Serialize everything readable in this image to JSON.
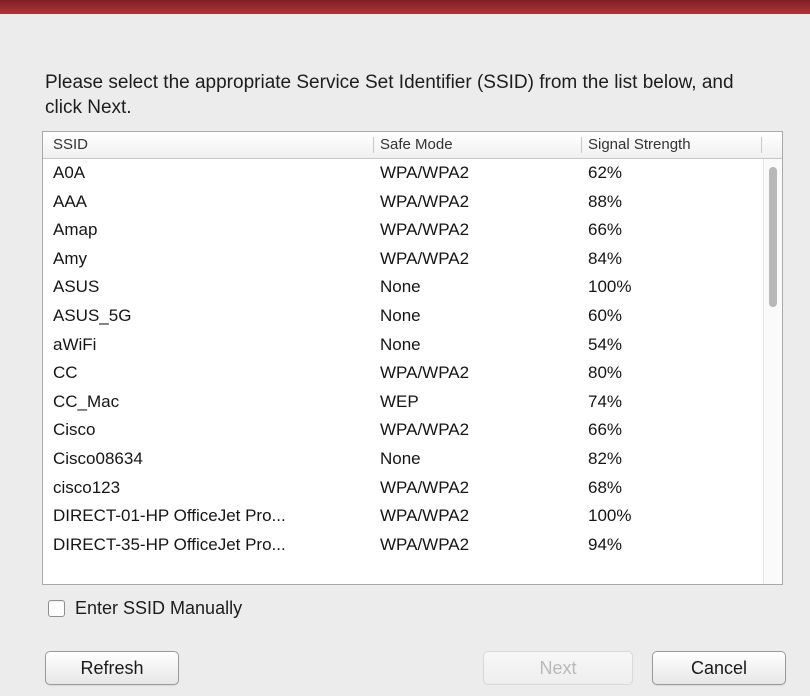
{
  "instructions": "Please select the appropriate Service Set Identifier (SSID) from the list below, and click Next.",
  "table": {
    "columns": [
      "SSID",
      "Safe Mode",
      "Signal Strength"
    ],
    "rows": [
      [
        "A0A",
        "WPA/WPA2",
        "62%"
      ],
      [
        "AAA",
        "WPA/WPA2",
        "88%"
      ],
      [
        "Amap",
        "WPA/WPA2",
        "66%"
      ],
      [
        "Amy",
        "WPA/WPA2",
        "84%"
      ],
      [
        "ASUS",
        "None",
        "100%"
      ],
      [
        "ASUS_5G",
        "None",
        "60%"
      ],
      [
        "aWiFi",
        "None",
        "54%"
      ],
      [
        "CC",
        "WPA/WPA2",
        "80%"
      ],
      [
        "CC_Mac",
        "WEP",
        "74%"
      ],
      [
        "Cisco",
        "WPA/WPA2",
        "66%"
      ],
      [
        "Cisco08634",
        "None",
        "82%"
      ],
      [
        "cisco123",
        "WPA/WPA2",
        "68%"
      ],
      [
        "DIRECT-01-HP OfficeJet Pro...",
        "WPA/WPA2",
        "100%"
      ],
      [
        "DIRECT-35-HP OfficeJet Pro...",
        "WPA/WPA2",
        "94%"
      ]
    ]
  },
  "manual_ssid": {
    "label": "Enter SSID Manually",
    "checked": false
  },
  "buttons": {
    "refresh": "Refresh",
    "next": "Next",
    "cancel": "Cancel"
  },
  "icons": {
    "checkbox": "checkbox-icon"
  }
}
